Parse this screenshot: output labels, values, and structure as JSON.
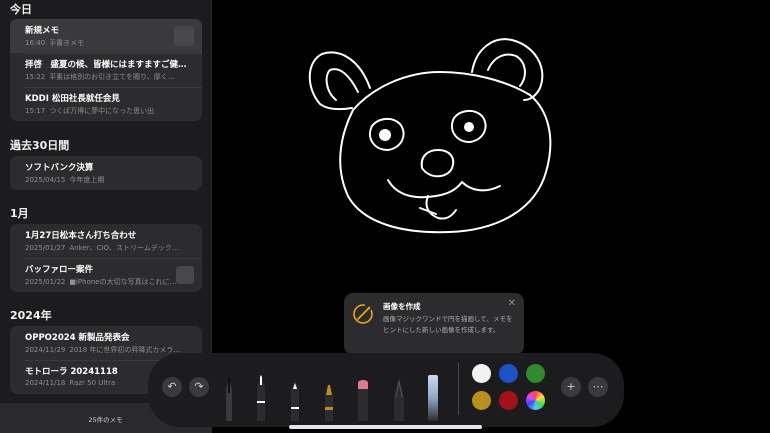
{
  "sidebar": {
    "sections": [
      {
        "title": "今日",
        "notes": [
          {
            "title": "新規メモ",
            "time": "16:40",
            "preview": "手書きメモ"
          },
          {
            "title": "拝啓　盛夏の候、皆様にはますますご健…",
            "time": "15:22",
            "preview": "平素は格別のお引き立てを賜り、厚く…"
          },
          {
            "title": "KDDI 松田社長就任会見",
            "time": "15:17",
            "preview": "つくば万博に夢中になった思い出"
          }
        ]
      },
      {
        "title": "過去30日間",
        "notes": [
          {
            "title": "ソフトバンク決算",
            "time": "2025/04/15",
            "preview": "今年度上期"
          }
        ]
      },
      {
        "title": "1月",
        "notes": [
          {
            "title": "1月27日松本さん打ち合わせ",
            "time": "2025/01/27",
            "preview": "Anker、CIO、ストリームデック…"
          },
          {
            "title": "バッファロー案件",
            "time": "2025/01/22",
            "preview": "■iPhoneの大切な写真はこれに…"
          }
        ]
      },
      {
        "title": "2024年",
        "notes": [
          {
            "title": "OPPO2024 新製品発表会",
            "time": "2024/11/29",
            "preview": "2018 年に世界初の昇降式カメラ…"
          },
          {
            "title": "モトローラ 20241118",
            "time": "2024/11/18",
            "preview": "Razr 50 Ultra"
          }
        ]
      }
    ],
    "note_count": "25件のメモ"
  },
  "tooltip": {
    "title": "画像を作成",
    "body": "画像マジックワンドで円を描画して、メモをヒントにした新しい画像を作成します。",
    "close": "✕",
    "icon": "image-wand-icon",
    "icon_color": "#e8a317"
  },
  "toolbar": {
    "undo": "↶",
    "redo": "↷",
    "add": "+",
    "more": "⋯",
    "tools": [
      "pen",
      "monoline",
      "fountain-pen",
      "watercolor",
      "crayon",
      "feather-pen",
      "ruler"
    ],
    "colors": [
      "#f2f2f2",
      "#1e52c8",
      "#2e8b2e",
      "#b7901e",
      "#a31218",
      "rainbow"
    ]
  },
  "accent": "#e8a317"
}
